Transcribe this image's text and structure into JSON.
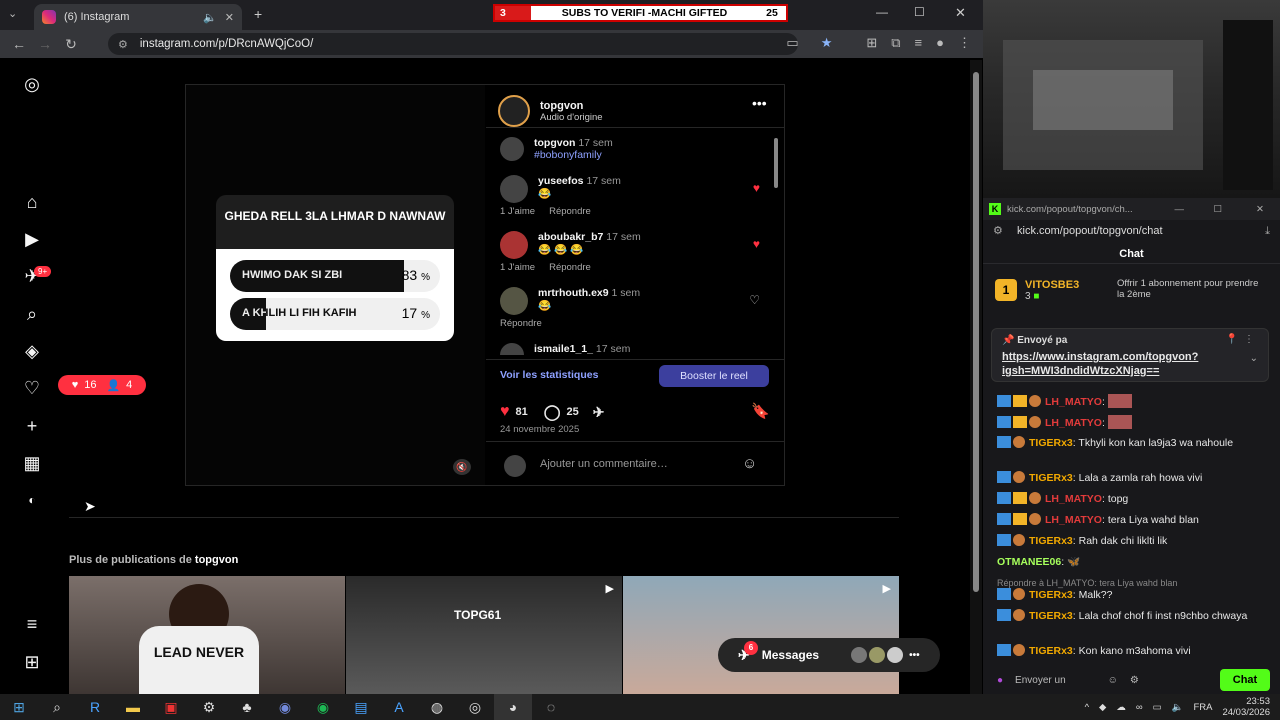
{
  "browser": {
    "tab_title": "(6) Instagram",
    "url": "instagram.com/p/DRcnAWQjCoO/"
  },
  "banner": {
    "left_count": "3",
    "text": "SUBS TO VERIFI -MACHI GIFTED",
    "right_count": "25"
  },
  "sidebar": {
    "messages_badge": "9+",
    "notif_likes": "16",
    "notif_follows": "4"
  },
  "post": {
    "poll": {
      "question": "GHEDA RELL 3LA LHMAR D NAWNAW",
      "options": [
        {
          "label": "HWIMO DAK SI ZBI",
          "percent": "83",
          "unit": "%",
          "fraction": 0.83
        },
        {
          "label": "A KHLIH LI FIH KAFIH",
          "percent": "17",
          "unit": "%",
          "fraction": 0.17
        }
      ]
    },
    "author": "topgvon",
    "audio": "Audio d'origine",
    "caption": {
      "user": "topgvon",
      "time": "17 sem",
      "text": "#bobonyfamily"
    },
    "comments": [
      {
        "user": "yuseefos",
        "time": "17 sem",
        "text": "😂",
        "likes": "1 J'aime",
        "reply": "Répondre",
        "liked": true
      },
      {
        "user": "aboubakr_b7",
        "time": "17 sem",
        "text": "😂 😂 😂",
        "likes": "1 J'aime",
        "reply": "Répondre",
        "liked": true
      },
      {
        "user": "mrtrhouth.ex9",
        "time": "1 sem",
        "text": "😂",
        "likes": "",
        "reply": "Répondre",
        "liked": false
      },
      {
        "user": "ismaile1_1_",
        "time": "17 sem",
        "text": "",
        "likes": "",
        "reply": "",
        "liked": false
      }
    ],
    "stats_link": "Voir les statistiques",
    "boost_label": "Booster le reel",
    "like_count": "81",
    "comment_count": "25",
    "date": "24 novembre 2025",
    "comment_placeholder": "Ajouter un commentaire…"
  },
  "more": {
    "prefix": "Plus de publications de",
    "user": "topgvon"
  },
  "thumbnails": {
    "shirt_text": "LEAD NEVER",
    "video_tag": "TOPG61"
  },
  "messages_bar": {
    "label": "Messages",
    "badge": "6"
  },
  "kick": {
    "window_title": "kick.com/popout/topgvon/ch...",
    "url": "kick.com/popout/topgvon/chat",
    "chat_header": "Chat",
    "top_gifter": {
      "rank": "1",
      "name": "VITOSBE3",
      "count": "3",
      "offer": "Offrir 1 abonnement pour prendre la 2ème"
    },
    "pinned": {
      "label": "Envoyé pa",
      "link": "https://www.instagram.com/topgvon?igsh=MWI3dndidWtzcXNjag=="
    },
    "messages": [
      {
        "user": "LH_MATYO",
        "text": "",
        "kind": "maty"
      },
      {
        "user": "LH_MATYO",
        "text": "",
        "kind": "maty"
      },
      {
        "user": "TIGERx3",
        "text": "Tkhyli kon kan la9ja3 wa nahoule",
        "kind": "tiger"
      },
      {
        "user": "TIGERx3",
        "text": "Lala a zamla rah howa vivi",
        "kind": "tiger"
      },
      {
        "user": "LH_MATYO",
        "text": "topg",
        "kind": "maty"
      },
      {
        "user": "LH_MATYO",
        "text": "tera Liya wahd blan",
        "kind": "maty"
      },
      {
        "user": "TIGERx3",
        "text": "Rah dak chi liklti lik",
        "kind": "tiger"
      },
      {
        "user": "OTMANEE06",
        "text": "🦋",
        "kind": "otm"
      },
      {
        "reply": "Répondre à LH_MATYO: tera Liya wahd blan",
        "user": "TIGERx3",
        "text": "Malk??",
        "kind": "tiger"
      },
      {
        "user": "TIGERx3",
        "text": "Lala chof chof fi inst n9chbo chwaya",
        "kind": "tiger"
      },
      {
        "user": "TIGERx3",
        "text": "Kon kano m3ahoma vivi",
        "kind": "tiger"
      }
    ],
    "input_placeholder": "Envoyer un",
    "send_label": "Chat"
  },
  "taskbar": {
    "lang": "FRA",
    "time": "23:53",
    "date": "24/03/2026"
  }
}
